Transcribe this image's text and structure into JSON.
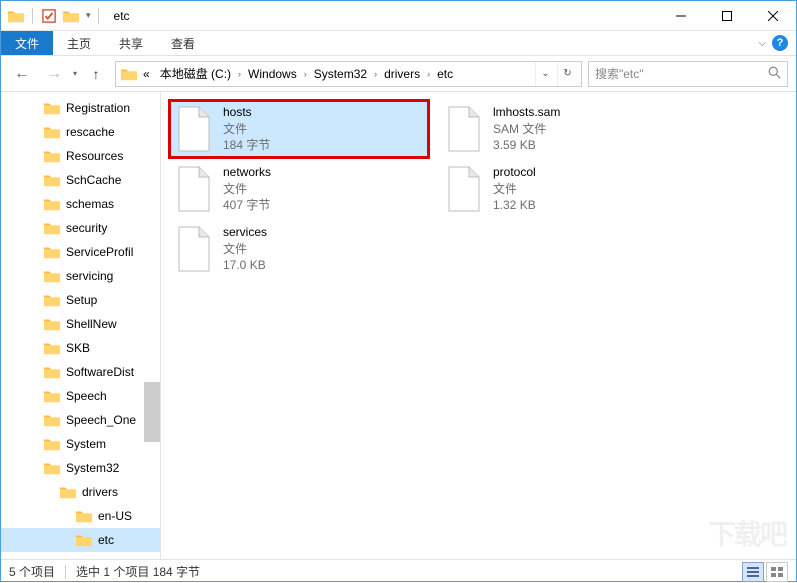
{
  "window": {
    "title": "etc"
  },
  "ribbon": {
    "tabs": [
      "文件",
      "主页",
      "共享",
      "查看"
    ],
    "active_index": 0
  },
  "breadcrumb": {
    "prefix": "«",
    "parts": [
      "本地磁盘 (C:)",
      "Windows",
      "System32",
      "drivers",
      "etc"
    ]
  },
  "search": {
    "placeholder": "搜索\"etc\""
  },
  "tree": [
    {
      "label": "Registration",
      "indent": 42
    },
    {
      "label": "rescache",
      "indent": 42
    },
    {
      "label": "Resources",
      "indent": 42
    },
    {
      "label": "SchCache",
      "indent": 42
    },
    {
      "label": "schemas",
      "indent": 42
    },
    {
      "label": "security",
      "indent": 42
    },
    {
      "label": "ServiceProfil",
      "indent": 42
    },
    {
      "label": "servicing",
      "indent": 42
    },
    {
      "label": "Setup",
      "indent": 42
    },
    {
      "label": "ShellNew",
      "indent": 42
    },
    {
      "label": "SKB",
      "indent": 42
    },
    {
      "label": "SoftwareDist",
      "indent": 42
    },
    {
      "label": "Speech",
      "indent": 42
    },
    {
      "label": "Speech_One",
      "indent": 42
    },
    {
      "label": "System",
      "indent": 42
    },
    {
      "label": "System32",
      "indent": 42
    },
    {
      "label": "drivers",
      "indent": 58
    },
    {
      "label": "en-US",
      "indent": 74
    },
    {
      "label": "etc",
      "indent": 74,
      "selected": true
    }
  ],
  "files": [
    {
      "name": "hosts",
      "type": "文件",
      "size": "184 字节",
      "selected": true,
      "highlight": true
    },
    {
      "name": "lmhosts.sam",
      "type": "SAM 文件",
      "size": "3.59 KB"
    },
    {
      "name": "networks",
      "type": "文件",
      "size": "407 字节"
    },
    {
      "name": "protocol",
      "type": "文件",
      "size": "1.32 KB"
    },
    {
      "name": "services",
      "type": "文件",
      "size": "17.0 KB"
    }
  ],
  "status": {
    "count": "5 个项目",
    "selection": "选中 1 个项目",
    "size": "184 字节"
  }
}
